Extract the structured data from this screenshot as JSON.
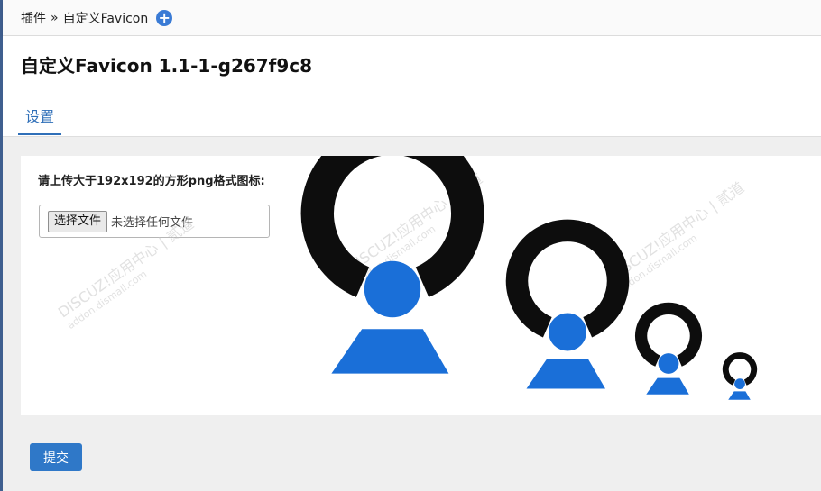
{
  "breadcrumb": {
    "root": "插件",
    "separator": "»",
    "current": "自定义Favicon"
  },
  "add_button": {
    "symbol": "+"
  },
  "page": {
    "title": "自定义Favicon 1.1-1-g267f9c8"
  },
  "tabs": [
    {
      "label": "设置",
      "active": true
    }
  ],
  "upload": {
    "label": "请上传大于192x192的方形png格式图标:",
    "choose_button": "选择文件",
    "status": "未选择任何文件"
  },
  "watermarks": [
    {
      "brand": "DISCUZ!应用中心 | 贰道",
      "site": "addon.dismall.com"
    },
    {
      "brand": "DISCUZ!应用中心 | 贰道",
      "site": "addon.dismall.com"
    },
    {
      "brand": "DISCUZ!应用中心 | 贰道",
      "site": "addon.dismall.com"
    }
  ],
  "icon_preview": {
    "icon_name": "user-logo-icon",
    "ring_color": "#0d0d0d",
    "figure_color": "#1a6fd8",
    "sizes": [
      "large",
      "medium",
      "small",
      "tiny"
    ]
  },
  "submit": {
    "label": "提交"
  },
  "colors": {
    "accent": "#2f78c8",
    "tab": "#2f6fb8",
    "add_button": "#3a7bd5"
  }
}
